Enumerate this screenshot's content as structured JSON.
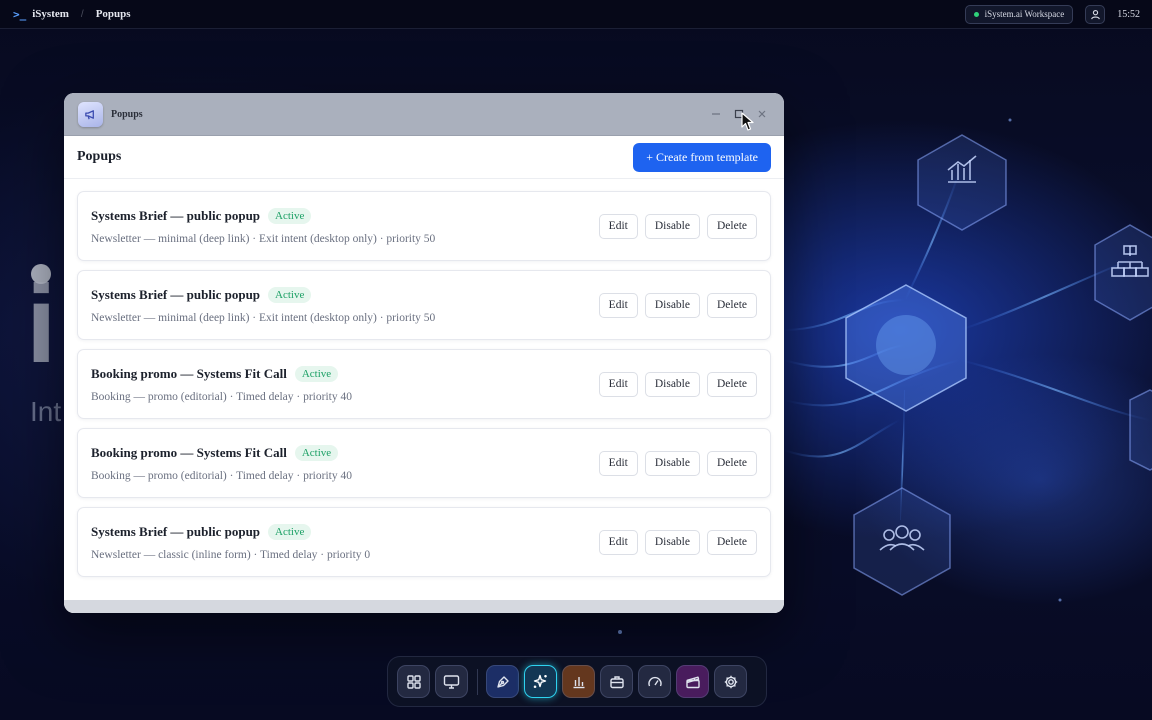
{
  "topbar": {
    "brand": "iSystem",
    "breadcrumb": "Popups",
    "workspace": "iSystem.ai Workspace",
    "clock": "15:52"
  },
  "desktop": {
    "hero_letter": "i",
    "hero_subtitle": "Int"
  },
  "window": {
    "title": "Popups",
    "icon": "megaphone-icon"
  },
  "page": {
    "title": "Popups",
    "create_label": "+ Create from template"
  },
  "popups": [
    {
      "name": "Systems Brief — public popup",
      "status": "Active",
      "meta": "Newsletter — minimal (deep link) · Exit intent (desktop only) · priority 50"
    },
    {
      "name": "Systems Brief — public popup",
      "status": "Active",
      "meta": "Newsletter — minimal (deep link) · Exit intent (desktop only) · priority 50"
    },
    {
      "name": "Booking promo — Systems Fit Call",
      "status": "Active",
      "meta": "Booking — promo (editorial) · Timed delay · priority 40"
    },
    {
      "name": "Booking promo — Systems Fit Call",
      "status": "Active",
      "meta": "Booking — promo (editorial) · Timed delay · priority 40"
    },
    {
      "name": "Systems Brief — public popup",
      "status": "Active",
      "meta": "Newsletter — classic (inline form) · Timed delay · priority 0"
    }
  ],
  "actions": {
    "edit": "Edit",
    "disable": "Disable",
    "delete": "Delete"
  },
  "dock": {
    "items": [
      "grid-icon",
      "monitor-icon",
      "pen-tool-icon",
      "sparkles-icon",
      "bar-chart-icon",
      "briefcase-icon",
      "gauge-icon",
      "clapperboard-icon",
      "gear-icon"
    ],
    "active": "sparkles-icon"
  },
  "colors": {
    "accent": "#1e63f0",
    "active_badge_text": "#1ca065",
    "active_badge_bg": "#e6f6ee",
    "dock_active": "#2ed3f0",
    "status_online": "#2fd27a"
  }
}
